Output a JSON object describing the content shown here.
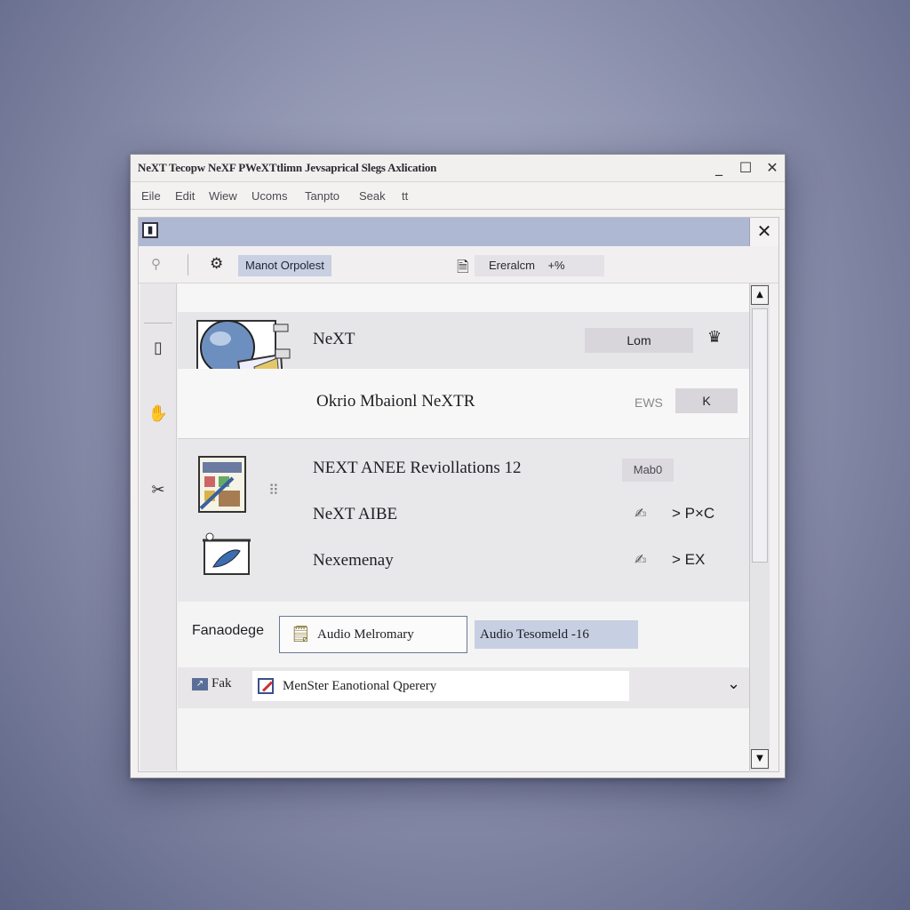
{
  "window": {
    "title": "NeXT Tecopw NeXF PWeXTtlimn Jevsaprical Slegs Axlication",
    "controls": {
      "minimize": "_",
      "maximize": "☐",
      "close": "✕"
    }
  },
  "menu": [
    "Eile",
    "Edit",
    "Wiew",
    "Ucoms",
    "Tanpto",
    "Seak",
    "tt"
  ],
  "toolbar": {
    "label": "Manot Orpolest",
    "status": "Ereralcm",
    "status_extra": "+%"
  },
  "rows": {
    "row1": {
      "title": "NeXT",
      "button": "Lom"
    },
    "row2": {
      "title": "Okrio Mbaionl NeXTR",
      "tag": "EWS",
      "button": "K"
    },
    "group": {
      "item1": {
        "title": "NEXT ANEE Reviollations 12",
        "chip": "Mab0"
      },
      "item2": {
        "title": "NeXT AIBE",
        "action": "P×C"
      },
      "item3": {
        "title": "Nexemenay",
        "action": "EX"
      }
    }
  },
  "form": {
    "label": "Fanaodege",
    "button_outline": "Audio Melromary",
    "button_filled": "Audio Tesomeld -16",
    "dropdown_label": "Fak",
    "dropdown_value": "MenSter Eanotional Qperery"
  },
  "colors": {
    "inner_header": "#aeb8d2",
    "accent": "#c7cfe2"
  }
}
